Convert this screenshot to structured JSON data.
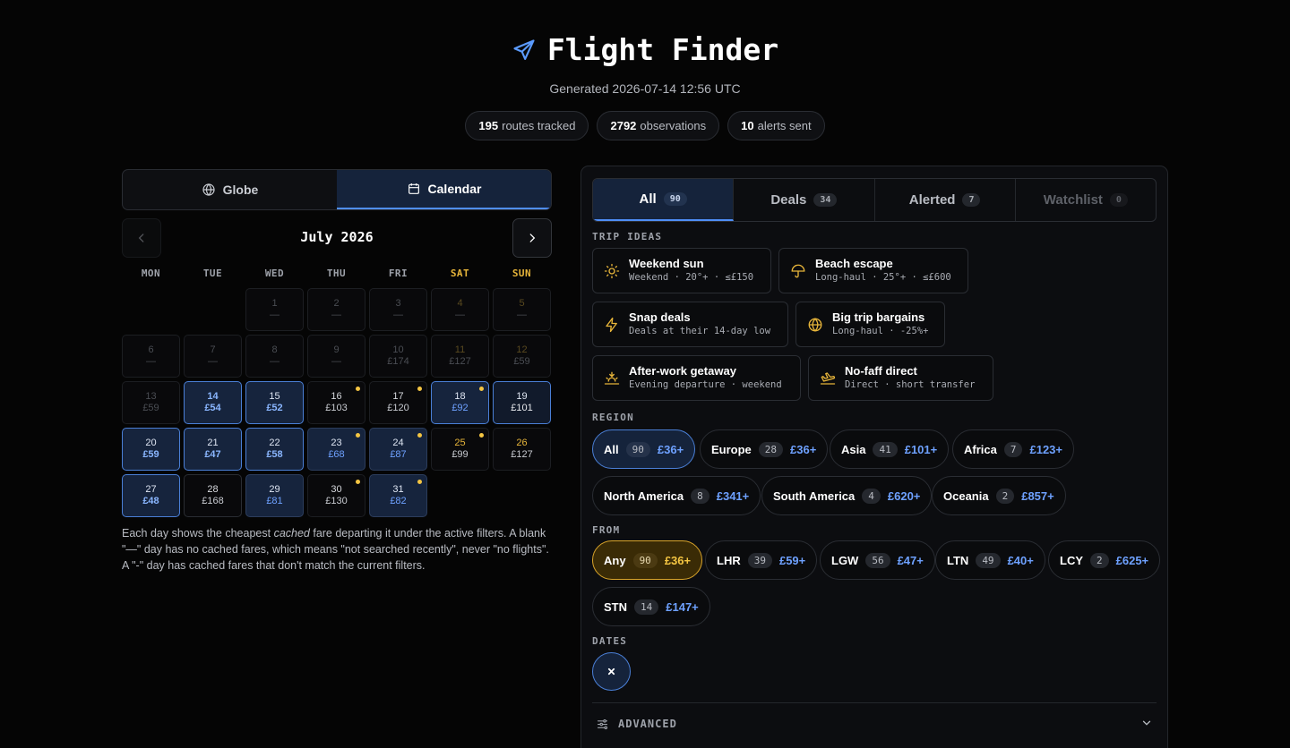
{
  "header": {
    "title": "Flight Finder",
    "generated": "Generated 2026-07-14 12:56 UTC",
    "stats": [
      {
        "value": "195",
        "label": "routes tracked"
      },
      {
        "value": "2792",
        "label": "observations"
      },
      {
        "value": "10",
        "label": "alerts sent"
      }
    ]
  },
  "view_toggle": {
    "globe": "Globe",
    "calendar": "Calendar",
    "active": "Calendar"
  },
  "calendar": {
    "month": "July 2026",
    "weekdays": [
      "MON",
      "TUE",
      "WED",
      "THU",
      "FRI",
      "SAT",
      "SUN"
    ],
    "days": [
      {
        "d": "1",
        "p": "—"
      },
      {
        "d": "2",
        "p": "—"
      },
      {
        "d": "3",
        "p": "—"
      },
      {
        "d": "4",
        "p": "—"
      },
      {
        "d": "5",
        "p": "—"
      },
      {
        "d": "6",
        "p": "—"
      },
      {
        "d": "7",
        "p": "—"
      },
      {
        "d": "8",
        "p": "—"
      },
      {
        "d": "9",
        "p": "—"
      },
      {
        "d": "10",
        "p": "£174"
      },
      {
        "d": "11",
        "p": "£127"
      },
      {
        "d": "12",
        "p": "£59"
      },
      {
        "d": "13",
        "p": "£59"
      },
      {
        "d": "14",
        "p": "£54"
      },
      {
        "d": "15",
        "p": "£52"
      },
      {
        "d": "16",
        "p": "£103"
      },
      {
        "d": "17",
        "p": "£120"
      },
      {
        "d": "18",
        "p": "£92"
      },
      {
        "d": "19",
        "p": "£101"
      },
      {
        "d": "20",
        "p": "£59"
      },
      {
        "d": "21",
        "p": "£47"
      },
      {
        "d": "22",
        "p": "£58"
      },
      {
        "d": "23",
        "p": "£68"
      },
      {
        "d": "24",
        "p": "£87"
      },
      {
        "d": "25",
        "p": "£99"
      },
      {
        "d": "26",
        "p": "£127"
      },
      {
        "d": "27",
        "p": "£48"
      },
      {
        "d": "28",
        "p": "£168"
      },
      {
        "d": "29",
        "p": "£81"
      },
      {
        "d": "30",
        "p": "£130"
      },
      {
        "d": "31",
        "p": "£82"
      }
    ],
    "note_parts": [
      "Each day shows the cheapest ",
      "cached",
      " fare departing it under the active filters. A blank \"—\" day has no cached fares, which means \"not searched recently\", never \"no flights\". A \"-\" day has cached fares that don't match the current filters."
    ]
  },
  "tabs": [
    {
      "label": "All",
      "count": "90"
    },
    {
      "label": "Deals",
      "count": "34"
    },
    {
      "label": "Alerted",
      "count": "7"
    },
    {
      "label": "Watchlist",
      "count": "0"
    }
  ],
  "trip_ideas": {
    "label": "TRIP IDEAS",
    "items": [
      {
        "title": "Weekend sun",
        "sub": "Weekend · 20°+ · ≤£150",
        "icon": "sun-icon"
      },
      {
        "title": "Beach escape",
        "sub": "Long-haul · 25°+ · ≤£600",
        "icon": "umbrella-icon"
      },
      {
        "title": "Snap deals",
        "sub": "Deals at their 14-day low",
        "icon": "lightning-icon"
      },
      {
        "title": "Big trip bargains",
        "sub": "Long-haul · -25%+",
        "icon": "globe-icon"
      },
      {
        "title": "After-work getaway",
        "sub": "Evening departure · weekend",
        "icon": "sunset-icon"
      },
      {
        "title": "No-faff direct",
        "sub": "Direct · short transfer",
        "icon": "landing-icon"
      }
    ]
  },
  "region": {
    "label": "REGION",
    "items": [
      {
        "name": "All",
        "count": "90",
        "price": "£36+"
      },
      {
        "name": "Europe",
        "count": "28",
        "price": "£36+"
      },
      {
        "name": "Asia",
        "count": "41",
        "price": "£101+"
      },
      {
        "name": "Africa",
        "count": "7",
        "price": "£123+"
      },
      {
        "name": "North America",
        "count": "8",
        "price": "£341+"
      },
      {
        "name": "South America",
        "count": "4",
        "price": "£620+"
      },
      {
        "name": "Oceania",
        "count": "2",
        "price": "£857+"
      }
    ]
  },
  "from": {
    "label": "FROM",
    "items": [
      {
        "name": "Any",
        "count": "90",
        "price": "£36+"
      },
      {
        "name": "LHR",
        "count": "39",
        "price": "£59+"
      },
      {
        "name": "LGW",
        "count": "56",
        "price": "£47+"
      },
      {
        "name": "LTN",
        "count": "49",
        "price": "£40+"
      },
      {
        "name": "LCY",
        "count": "2",
        "price": "£625+"
      },
      {
        "name": "STN",
        "count": "14",
        "price": "£147+"
      }
    ]
  },
  "dates": {
    "label": "DATES"
  },
  "advanced": {
    "label": "ADVANCED"
  },
  "colors": {
    "accent": "#4f8ef7",
    "highlight_bg": "#15233b",
    "weekend": "#e7b53a",
    "amber_dot": "#f4c542"
  }
}
